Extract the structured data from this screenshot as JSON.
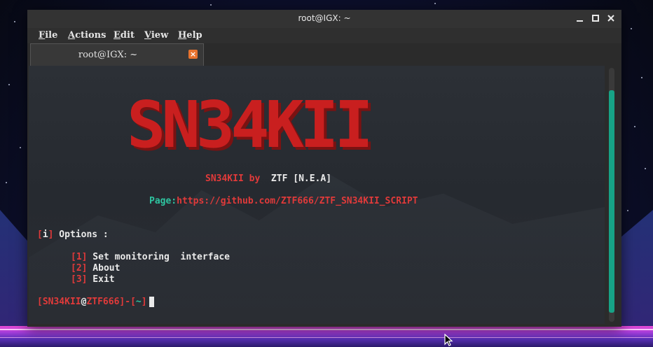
{
  "window": {
    "title": "root@IGX: ~"
  },
  "menu": {
    "items": [
      {
        "label": "File",
        "key": "F",
        "rest": "ile"
      },
      {
        "label": "Actions",
        "key": "A",
        "rest": "ctions"
      },
      {
        "label": "Edit",
        "key": "E",
        "rest": "dit"
      },
      {
        "label": "View",
        "key": "V",
        "rest": "iew"
      },
      {
        "label": "Help",
        "key": "H",
        "rest": "elp"
      }
    ]
  },
  "tab": {
    "label": "root@IGX: ~",
    "close_glyph": "×"
  },
  "terminal": {
    "banner": "SN34KII",
    "byline": {
      "name": "SN34KII",
      "by": " by ",
      "author": " ZTF [N.E.A]"
    },
    "page": {
      "label": "Page:",
      "url": "https://github.com/ZTF666/ZTF_SN34KII_SCRIPT"
    },
    "options_header": {
      "bracket_open": "[",
      "marker": "i",
      "bracket_close": "]",
      "text": " Options :"
    },
    "options": [
      {
        "num": "1",
        "text": " Set monitoring  interface"
      },
      {
        "num": "2",
        "text": " About"
      },
      {
        "num": "3",
        "text": " Exit"
      }
    ],
    "prompt": {
      "open": "[",
      "user": "SN34KII",
      "at": "@",
      "host": "ZTF666",
      "sep": "]-[",
      "path": "~",
      "close": "]"
    }
  },
  "colors": {
    "accent_red": "#e03a3a",
    "accent_teal": "#2ec4a0",
    "scroll_thumb": "#17a386",
    "tab_close": "#e8732e"
  }
}
